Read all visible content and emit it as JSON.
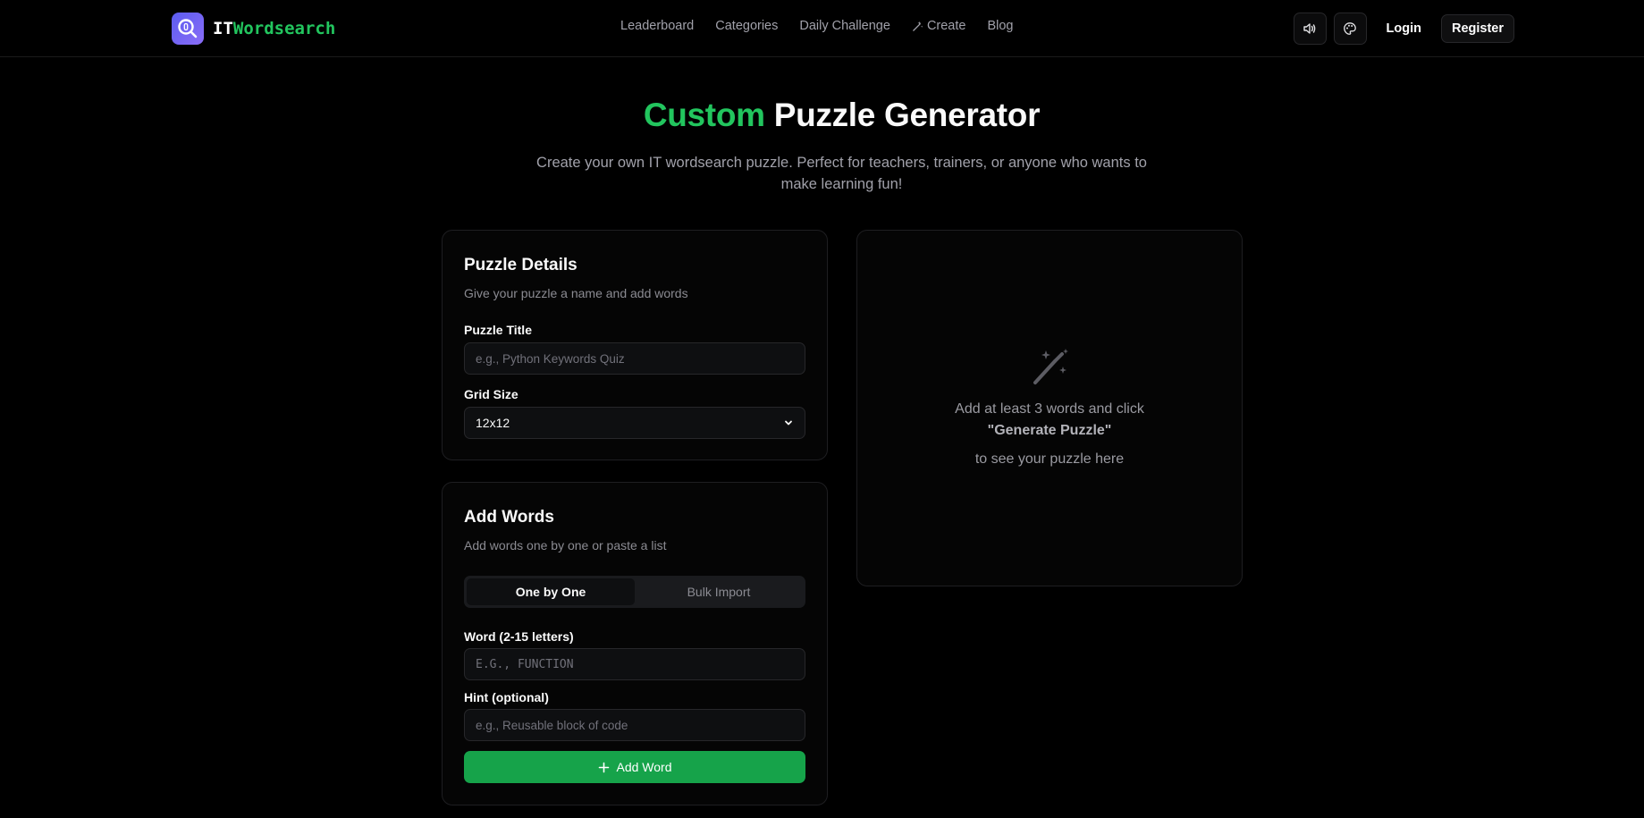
{
  "brand": {
    "name_a": "IT",
    "name_b": "Wordsearch",
    "logo_icon": "magnifier-icon"
  },
  "nav": {
    "items": [
      "Leaderboard",
      "Categories",
      "Daily Challenge",
      "Create",
      "Blog"
    ]
  },
  "header": {
    "sound_icon": "speaker-icon",
    "theme_icon": "palette-icon",
    "login": "Login",
    "register": "Register"
  },
  "hero": {
    "title_accent": "Custom",
    "title_rest": "Puzzle Generator",
    "subtitle": "Create your own IT wordsearch puzzle. Perfect for teachers, trainers, or anyone who wants to make learning fun!"
  },
  "details": {
    "title": "Puzzle Details",
    "desc": "Give your puzzle a name and add words",
    "title_label": "Puzzle Title",
    "title_placeholder": "e.g., Python Keywords Quiz",
    "grid_label": "Grid Size",
    "grid_value": "12x12"
  },
  "words": {
    "title": "Add Words",
    "desc": "Add words one by one or paste a list",
    "tab_one": "One by One",
    "tab_bulk": "Bulk Import",
    "word_label": "Word (2-15 letters)",
    "word_placeholder": "E.G., FUNCTION",
    "hint_label": "Hint (optional)",
    "hint_placeholder": "e.g., Reusable block of code",
    "add_button": "Add Word"
  },
  "preview": {
    "line1": "Add at least 3 words and click",
    "strong": "\"Generate Puzzle\"",
    "line2": "to see your puzzle here",
    "icon": "magic-wand-icon"
  },
  "colors": {
    "accent": "#22c55e",
    "button": "#16a34a",
    "logo_bg": "#6366f1"
  }
}
